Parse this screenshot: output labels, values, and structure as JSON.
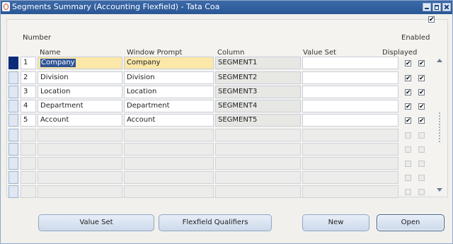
{
  "window": {
    "title": "Segments Summary (Accounting Flexfield) - Tata Coa",
    "title_controls": [
      "minimize-icon",
      "maximize-icon",
      "close-icon"
    ]
  },
  "colors": {
    "titlebar": "#2f5d9f",
    "selected_field": "#fbe7a8",
    "current_row_indicator": "#0b2a7a",
    "button_face": "#d6e2f0"
  },
  "headers": {
    "number": "Number",
    "name": "Name",
    "window_prompt": "Window Prompt",
    "column": "Column",
    "value_set": "Value Set",
    "displayed": "Displayed",
    "enabled": "Enabled"
  },
  "top_checkbox": "✔",
  "rows": [
    {
      "number": "1",
      "name": "Company",
      "prompt": "Company",
      "column": "SEGMENT1",
      "value_set": "",
      "displayed": "✔",
      "enabled": "✔"
    },
    {
      "number": "2",
      "name": "Division",
      "prompt": "Division",
      "column": "SEGMENT2",
      "value_set": "",
      "displayed": "✔",
      "enabled": "✔"
    },
    {
      "number": "3",
      "name": "Location",
      "prompt": "Location",
      "column": "SEGMENT3",
      "value_set": "",
      "displayed": "✔",
      "enabled": "✔"
    },
    {
      "number": "4",
      "name": "Department",
      "prompt": "Department",
      "column": "SEGMENT4",
      "value_set": "",
      "displayed": "✔",
      "enabled": "✔"
    },
    {
      "number": "5",
      "name": "Account",
      "prompt": "Account",
      "column": "SEGMENT5",
      "value_set": "",
      "displayed": "✔",
      "enabled": "✔"
    },
    {
      "number": "",
      "name": "",
      "prompt": "",
      "column": "",
      "value_set": "",
      "displayed": "",
      "enabled": ""
    },
    {
      "number": "",
      "name": "",
      "prompt": "",
      "column": "",
      "value_set": "",
      "displayed": "",
      "enabled": ""
    },
    {
      "number": "",
      "name": "",
      "prompt": "",
      "column": "",
      "value_set": "",
      "displayed": "",
      "enabled": ""
    },
    {
      "number": "",
      "name": "",
      "prompt": "",
      "column": "",
      "value_set": "",
      "displayed": "",
      "enabled": ""
    },
    {
      "number": "",
      "name": "",
      "prompt": "",
      "column": "",
      "value_set": "",
      "displayed": "",
      "enabled": ""
    }
  ],
  "buttons": {
    "value_set": "Value Set",
    "flexfield_qualifiers": "Flexfield Qualifiers",
    "new": "New",
    "open": "Open"
  }
}
